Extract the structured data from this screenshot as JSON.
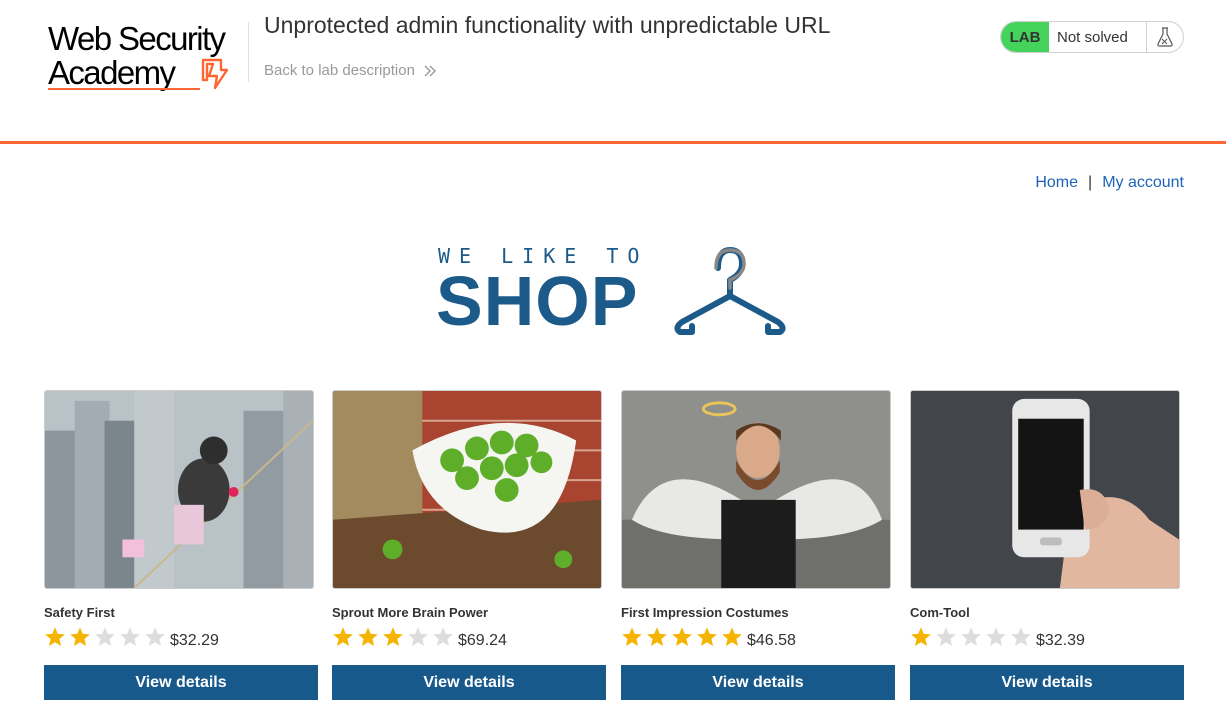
{
  "header": {
    "logo_line1": "Web Security",
    "logo_line2": "Academy",
    "lab_title": "Unprotected admin functionality with unpredictable URL",
    "back_link": "Back to lab description",
    "lab_badge": "LAB",
    "lab_status": "Not solved"
  },
  "nav": {
    "home": "Home",
    "separator": "|",
    "my_account": "My account"
  },
  "banner": {
    "tagline": "WE LIKE TO",
    "word": "SHOP"
  },
  "products": [
    {
      "name": "Safety First",
      "rating": 2,
      "price": "$32.29",
      "button": "View details",
      "image": "child-on-tightrope-over-city"
    },
    {
      "name": "Sprout More Brain Power",
      "rating": 3,
      "price": "$69.24",
      "button": "View details",
      "image": "bowl-of-brussels-sprouts"
    },
    {
      "name": "First Impression Costumes",
      "rating": 5,
      "price": "$46.58",
      "button": "View details",
      "image": "man-with-angel-wings-and-halo"
    },
    {
      "name": "Com-Tool",
      "rating": 1,
      "price": "$32.39",
      "button": "View details",
      "image": "hand-holding-smartphone"
    }
  ],
  "colors": {
    "accent": "#ff6633",
    "brand_blue": "#18598b",
    "link_blue": "#1c63b7",
    "lab_green": "#44d45b",
    "star_filled": "#f5b400",
    "star_empty": "#dddddd"
  }
}
